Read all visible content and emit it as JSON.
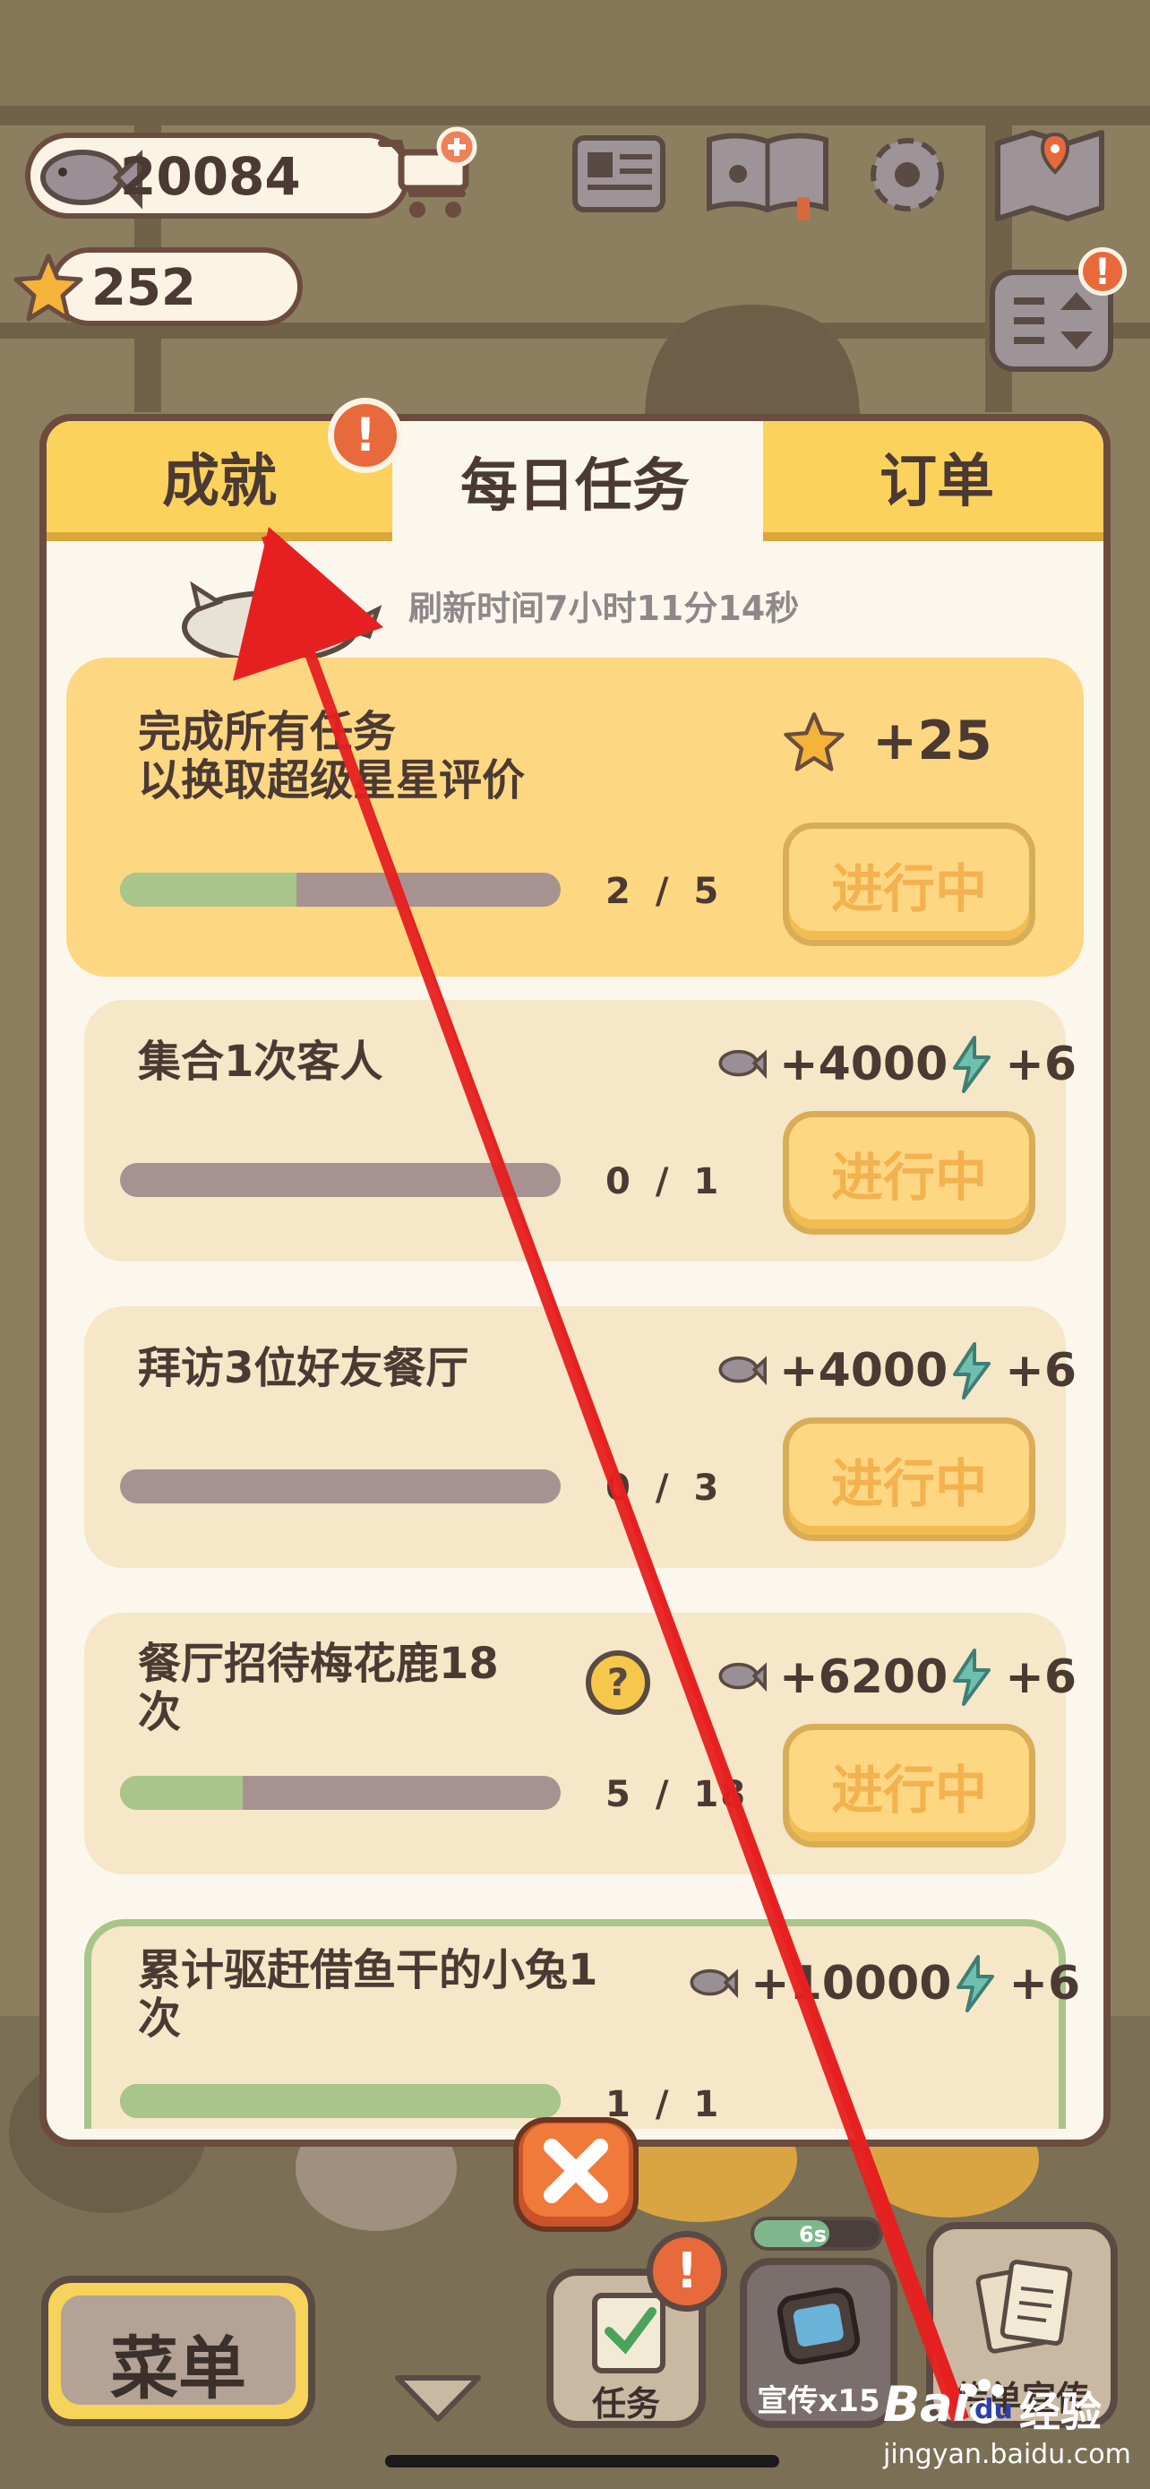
{
  "hud": {
    "fish_count": "20084",
    "star_count": "252"
  },
  "tabs": [
    {
      "label": "成就",
      "active": false,
      "alert": true
    },
    {
      "label": "每日任务",
      "active": true
    },
    {
      "label": "订单",
      "active": false
    }
  ],
  "refresh_text": "刷新时间7小时11分14秒",
  "tasks": [
    {
      "title": "完成所有任务\n以换取超级星星评价",
      "progress": 2,
      "total": 5,
      "reward_star": "+25",
      "status": "进行中"
    },
    {
      "title": "集合1次客人",
      "progress": 0,
      "total": 1,
      "reward_fish": "+4000",
      "reward_energy": "+6",
      "status": "进行中"
    },
    {
      "title": "拜访3位好友餐厅",
      "progress": 0,
      "total": 3,
      "reward_fish": "+4000",
      "reward_energy": "+6",
      "status": "进行中"
    },
    {
      "title": "餐厅招待梅花鹿18\n次",
      "progress": 5,
      "total": 18,
      "reward_fish": "+6200",
      "reward_energy": "+6",
      "status": "进行中"
    },
    {
      "title": "累计驱赶借鱼干的小兔1\n次",
      "progress": 1,
      "total": 1,
      "reward_fish": "+10000",
      "reward_energy": "+6",
      "status": ""
    }
  ],
  "bottom": {
    "menu_label": "菜单",
    "task_label": "任务",
    "promo_label": "宣传x15",
    "promo_timer": "6s",
    "flyer_label": "传单宣传"
  },
  "watermark": {
    "brand": "Bai",
    "brand2": "du",
    "cn": "经验",
    "url": "jingyan.baidu.com"
  },
  "colors": {
    "panel_border": "#6b4c3f",
    "tab_inactive": "#fbd25b",
    "card_highlight": "#fed782",
    "card": "#f5e7c7",
    "progress_fill": "#a8c58a",
    "progress_track": "#a69391",
    "alert": "#e8693b",
    "arrow": "#e62020"
  }
}
